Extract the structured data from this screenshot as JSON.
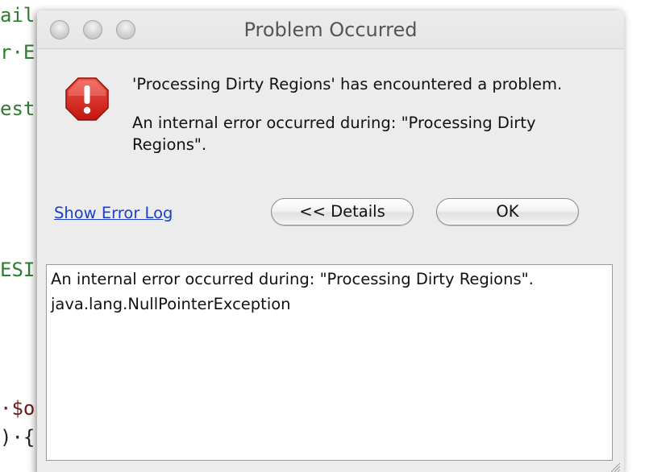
{
  "background_code": {
    "lines": [
      {
        "text": "ail",
        "color": "green"
      },
      {
        "text": "r·E",
        "color": "green"
      },
      {
        "text": "est",
        "color": "green"
      },
      {
        "text": "ESI",
        "color": "green"
      },
      {
        "text": "·$o",
        "color": "maroon"
      },
      {
        "text": ")·{",
        "color": "dark"
      }
    ]
  },
  "window": {
    "title": "Problem Occurred"
  },
  "message": {
    "headline": "'Processing Dirty Regions' has encountered a problem.",
    "detail": "An internal error occurred during: \"Processing Dirty Regions\"."
  },
  "links": {
    "show_error_log": "Show Error Log"
  },
  "buttons": {
    "details": "<< Details",
    "ok": "OK"
  },
  "details_area": {
    "lines": [
      "An internal error occurred during: \"Processing Dirty Regions\".",
      "java.lang.NullPointerException"
    ]
  },
  "colors": {
    "error_icon": "#d9211a",
    "link": "#1b3fc9",
    "dialog_background": "#ececec"
  },
  "icons": {
    "error": "error-octagon-icon"
  }
}
